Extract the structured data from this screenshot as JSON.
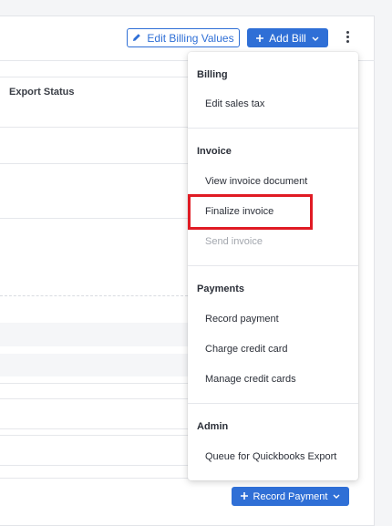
{
  "header": {
    "edit_billing_label": "Edit Billing Values",
    "add_bill_label": "Add Bill"
  },
  "table": {
    "export_status_header": "Export Status"
  },
  "menu": {
    "billing_heading": "Billing",
    "edit_sales_tax": "Edit sales tax",
    "invoice_heading": "Invoice",
    "view_invoice_document": "View invoice document",
    "finalize_invoice": "Finalize invoice",
    "send_invoice": "Send invoice",
    "payments_heading": "Payments",
    "record_payment": "Record payment",
    "charge_credit_card": "Charge credit card",
    "manage_credit_cards": "Manage credit cards",
    "admin_heading": "Admin",
    "queue_quickbooks": "Queue for Quickbooks Export"
  },
  "footer": {
    "record_payment_label": "Record Payment"
  },
  "colors": {
    "accent": "#2f6fd6",
    "highlight": "#e01b24"
  }
}
